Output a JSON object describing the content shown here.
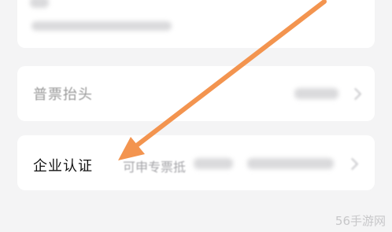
{
  "rows": {
    "invoice_title": {
      "label": "普票抬头"
    },
    "enterprise_cert": {
      "label": "企业认证",
      "hint": "可申专票抵"
    }
  },
  "watermark": "56手游网",
  "colors": {
    "background": "#f4f4f5",
    "card": "#ffffff",
    "arrow": "#f3944f"
  },
  "icons": {
    "annotation": "arrow-annotation-icon",
    "chevron": "chevron-right-icon"
  }
}
